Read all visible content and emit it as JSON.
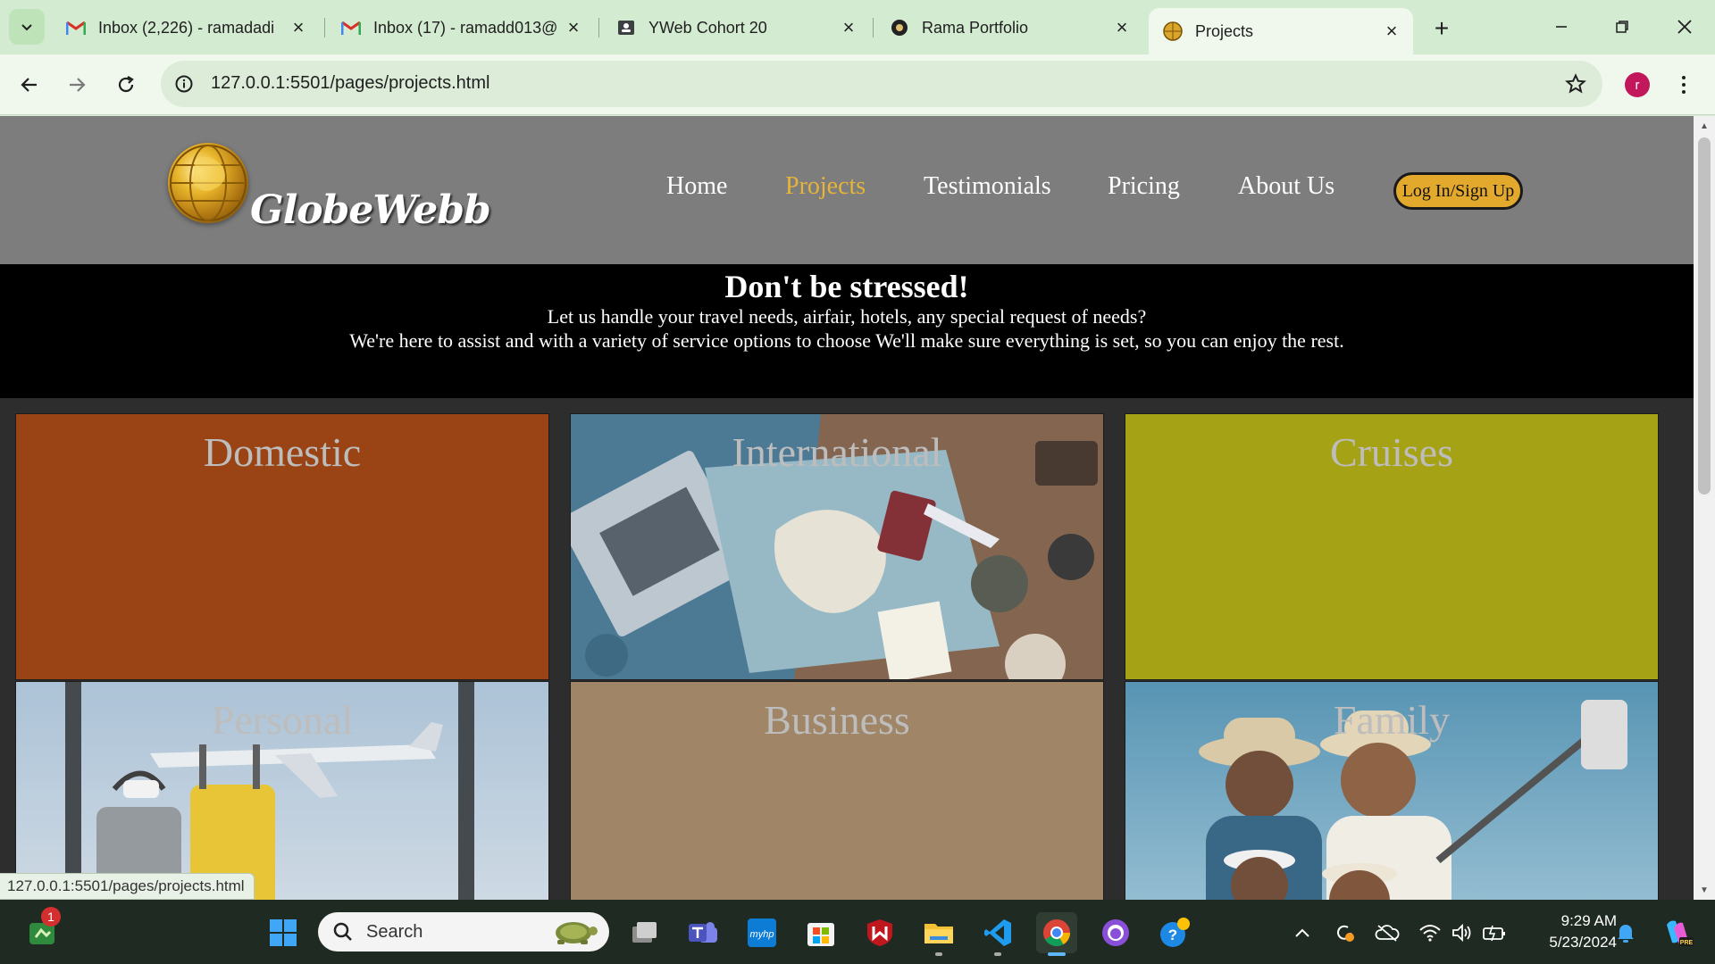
{
  "browser": {
    "tabs": [
      {
        "title": "Inbox (2,226) - ramadadi",
        "icon": "gmail-icon"
      },
      {
        "title": "Inbox (17) - ramadd013@",
        "icon": "gmail-icon"
      },
      {
        "title": "YWeb Cohort 20",
        "icon": "classroom-icon"
      },
      {
        "title": "Rama Portfolio",
        "icon": "portfolio-icon"
      },
      {
        "title": "Projects",
        "icon": "globe-favicon-icon",
        "active": true
      }
    ],
    "url": "127.0.0.1:5501/pages/projects.html",
    "profile_initial": "r",
    "status_url": "127.0.0.1:5501/pages/projects.html"
  },
  "site": {
    "brand": "GlobeWebb",
    "nav": [
      {
        "label": "Home"
      },
      {
        "label": "Projects",
        "active": true
      },
      {
        "label": "Testimonials"
      },
      {
        "label": "Pricing"
      },
      {
        "label": "About Us"
      }
    ],
    "login_label": "Log In/Sign Up",
    "accent_color": "#e7b43a",
    "hero": {
      "title": "Don't be stressed!",
      "line1": "Let us handle your travel needs, airfair, hotels, any special request of needs?",
      "line2": "We're here to assist and with a variety of service options to choose We'll make sure everything is set, so you can enjoy the rest."
    },
    "cards": [
      {
        "title": "Domestic",
        "color": "#9a4415"
      },
      {
        "title": "International",
        "image": "travel-map-laptop-photo"
      },
      {
        "title": "Cruises",
        "color": "#a6a216"
      },
      {
        "title": "Personal",
        "image": "airport-luggage-photo"
      },
      {
        "title": "Business",
        "color": "#a08566"
      },
      {
        "title": "Family",
        "image": "family-selfie-photo"
      }
    ]
  },
  "taskbar": {
    "search_label": "Search",
    "time": "9:29 AM",
    "date": "5/23/2024",
    "notification_badge": "1"
  }
}
